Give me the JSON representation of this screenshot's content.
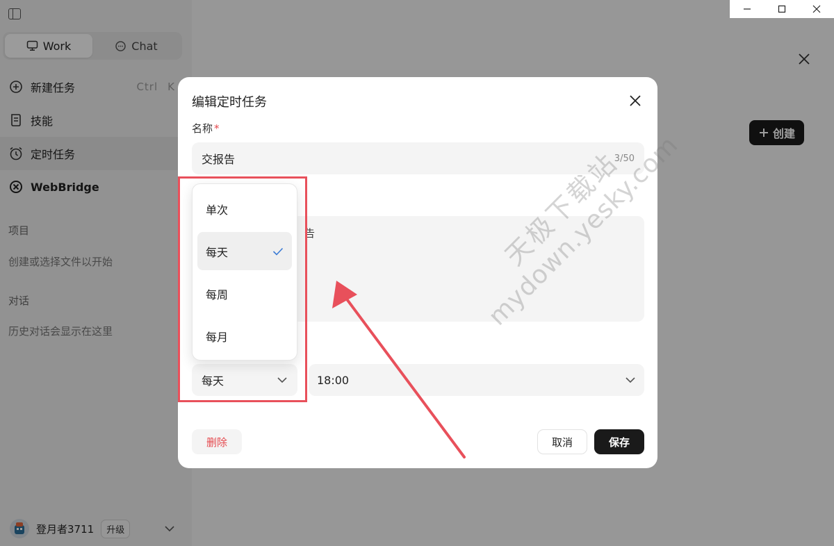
{
  "sidebar": {
    "modes": [
      {
        "label": "Work",
        "icon": "monitor-icon",
        "active": true
      },
      {
        "label": "Chat",
        "icon": "chat-bubble-icon",
        "active": false
      }
    ],
    "nav": [
      {
        "label": "新建任务",
        "icon": "new-task-icon",
        "shortcut_key1": "Ctrl",
        "shortcut_key2": "K"
      },
      {
        "label": "技能",
        "icon": "skills-icon"
      },
      {
        "label": "定时任务",
        "icon": "alarm-clock-icon",
        "active": true
      },
      {
        "label": "WebBridge",
        "icon": "webbridge-icon"
      }
    ],
    "projects_heading": "项目",
    "projects_hint": "创建或选择文件以开始",
    "conversations_heading": "对话",
    "conversations_hint": "历史对话会显示在这里",
    "user": {
      "name": "登月者3711",
      "upgrade_label": "升级"
    }
  },
  "main": {
    "create_label": "创建"
  },
  "dialog": {
    "title": "编辑定时任务",
    "name_label": "名称",
    "name_required_mark": "*",
    "name_value": "交报告",
    "name_counter": "3/50",
    "desc_partial_text": "告",
    "frequency_value": "每天",
    "time_value": "18:00",
    "delete_label": "删除",
    "cancel_label": "取消",
    "save_label": "保存"
  },
  "dropdown": {
    "options": [
      "单次",
      "每天",
      "每周",
      "每月"
    ],
    "selected": "每天"
  },
  "watermark": {
    "line1": "天极下载站",
    "line2": "mydown.yesky.com"
  },
  "colors": {
    "accent_dark": "#1a1a1a",
    "danger": "#e5484d",
    "annotation_red": "#e8505b",
    "check_blue": "#3a7bd5"
  }
}
